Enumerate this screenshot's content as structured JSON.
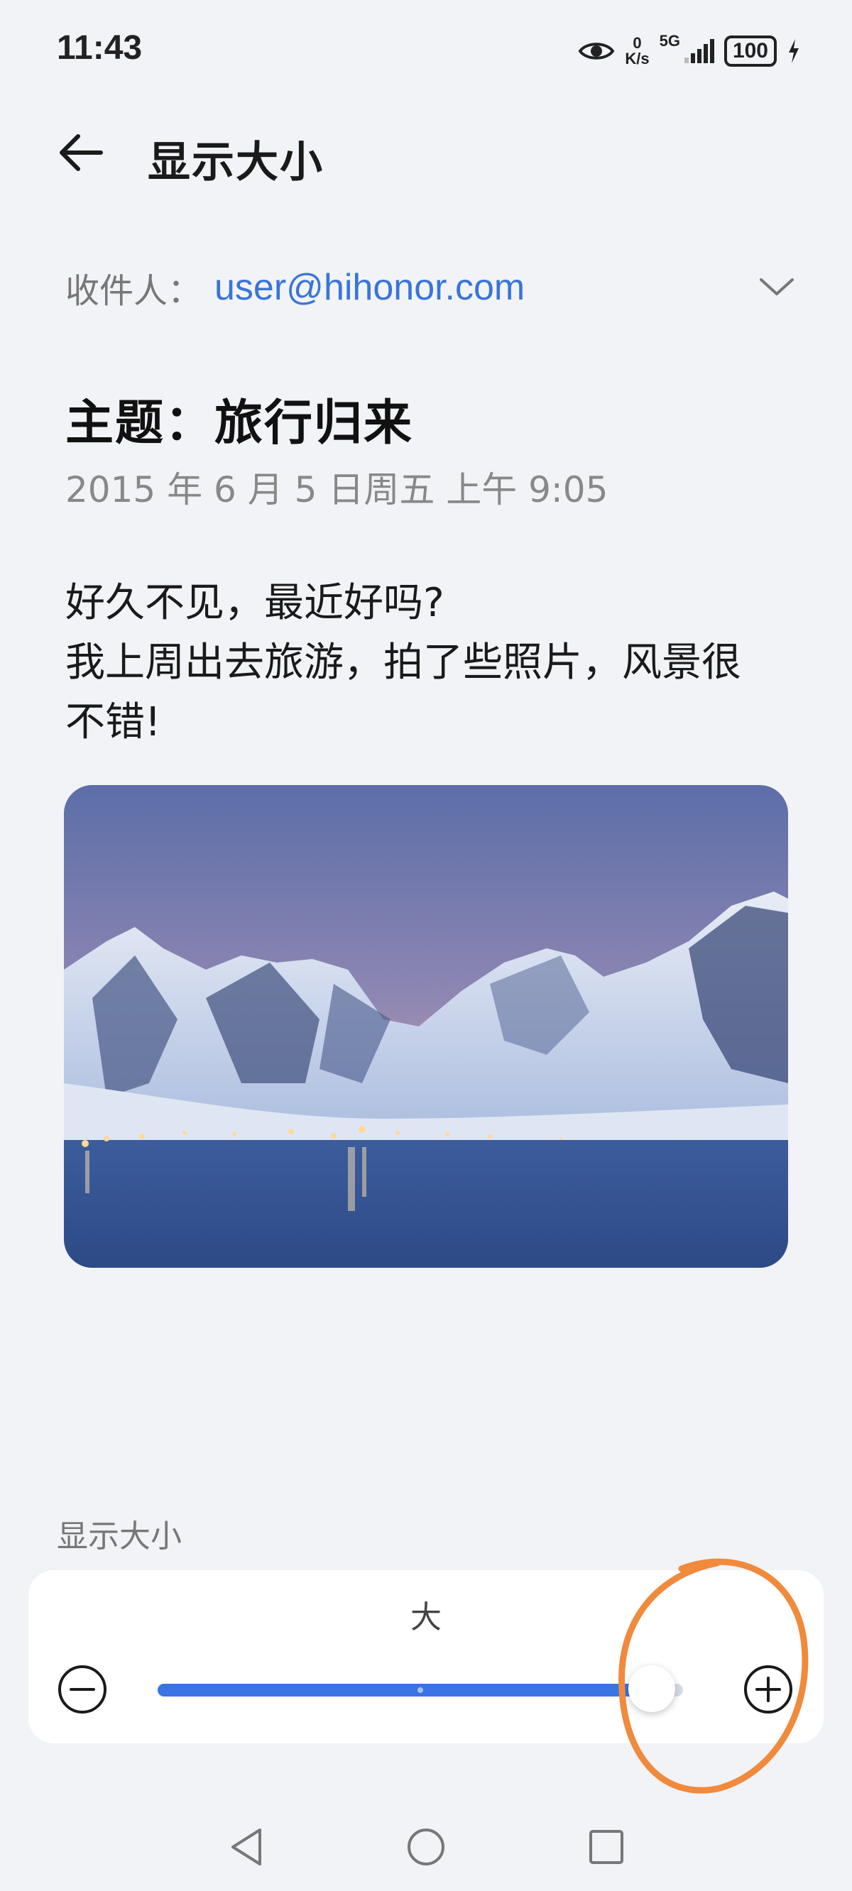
{
  "status_bar": {
    "time": "11:43",
    "net_speed_value": "0",
    "net_speed_unit": "K/s",
    "network": "5G",
    "battery": "100",
    "icons": [
      "eye-icon",
      "signal-icon",
      "battery-icon",
      "charging-icon"
    ]
  },
  "header": {
    "title": "显示大小",
    "back_icon": "back-arrow-icon"
  },
  "email": {
    "recipient_label": "收件人：",
    "recipient": "user@hihonor.com",
    "subject": "主题：旅行归来",
    "date": "2015 年 6 月 5 日周五 上午 9:05",
    "body_lines": [
      "好久不见，最近好吗?",
      "我上周出去旅游，拍了些照片，风景很",
      "不错!"
    ]
  },
  "display_size": {
    "section_label": "显示大小",
    "current_level": "大",
    "slider_position": 0.94,
    "slider_ticks": [
      0.5
    ],
    "colors": {
      "track_fill": "#3a74e4",
      "track_bg": "#d8dce3",
      "annotation": "#f08a3c"
    }
  },
  "nav": {
    "icons": [
      "nav-back-icon",
      "nav-home-icon",
      "nav-recent-icon"
    ]
  },
  "accent_color": "#3a74d8"
}
